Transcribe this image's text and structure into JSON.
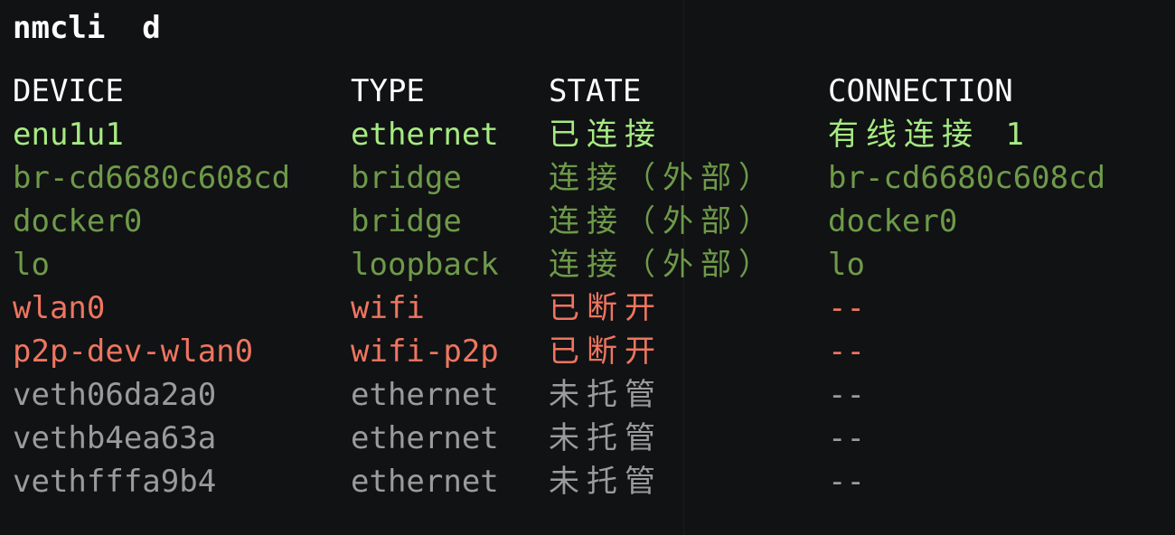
{
  "terminal": {
    "command": "nmcli  d",
    "headers": {
      "device": "DEVICE",
      "type": "TYPE",
      "state": "STATE",
      "connection": "CONNECTION"
    },
    "rows": [
      {
        "device": "enu1u1",
        "type": "ethernet",
        "state": "已连接",
        "connection": "有线连接 1"
      },
      {
        "device": "br-cd6680c608cd",
        "type": "bridge",
        "state": "连接（外部）",
        "connection": "br-cd6680c608cd"
      },
      {
        "device": "docker0",
        "type": "bridge",
        "state": "连接（外部）",
        "connection": "docker0"
      },
      {
        "device": "lo",
        "type": "loopback",
        "state": "连接（外部）",
        "connection": "lo"
      },
      {
        "device": "wlan0",
        "type": "wifi",
        "state": "已断开",
        "connection": "--"
      },
      {
        "device": "p2p-dev-wlan0",
        "type": "wifi-p2p",
        "state": "已断开",
        "connection": "--"
      },
      {
        "device": "veth06da2a0",
        "type": "ethernet",
        "state": "未托管",
        "connection": "--"
      },
      {
        "device": "vethb4ea63a",
        "type": "ethernet",
        "state": "未托管",
        "connection": "--"
      },
      {
        "device": "vethfffa9b4",
        "type": "ethernet",
        "state": "未托管",
        "connection": "--"
      }
    ]
  },
  "colors": {
    "background": "#111214",
    "header": "#ffffff",
    "connected": "#a6ea82",
    "external": "#6e9a49",
    "disconnected": "#ee7560",
    "unmanaged": "#9b9b9b"
  }
}
